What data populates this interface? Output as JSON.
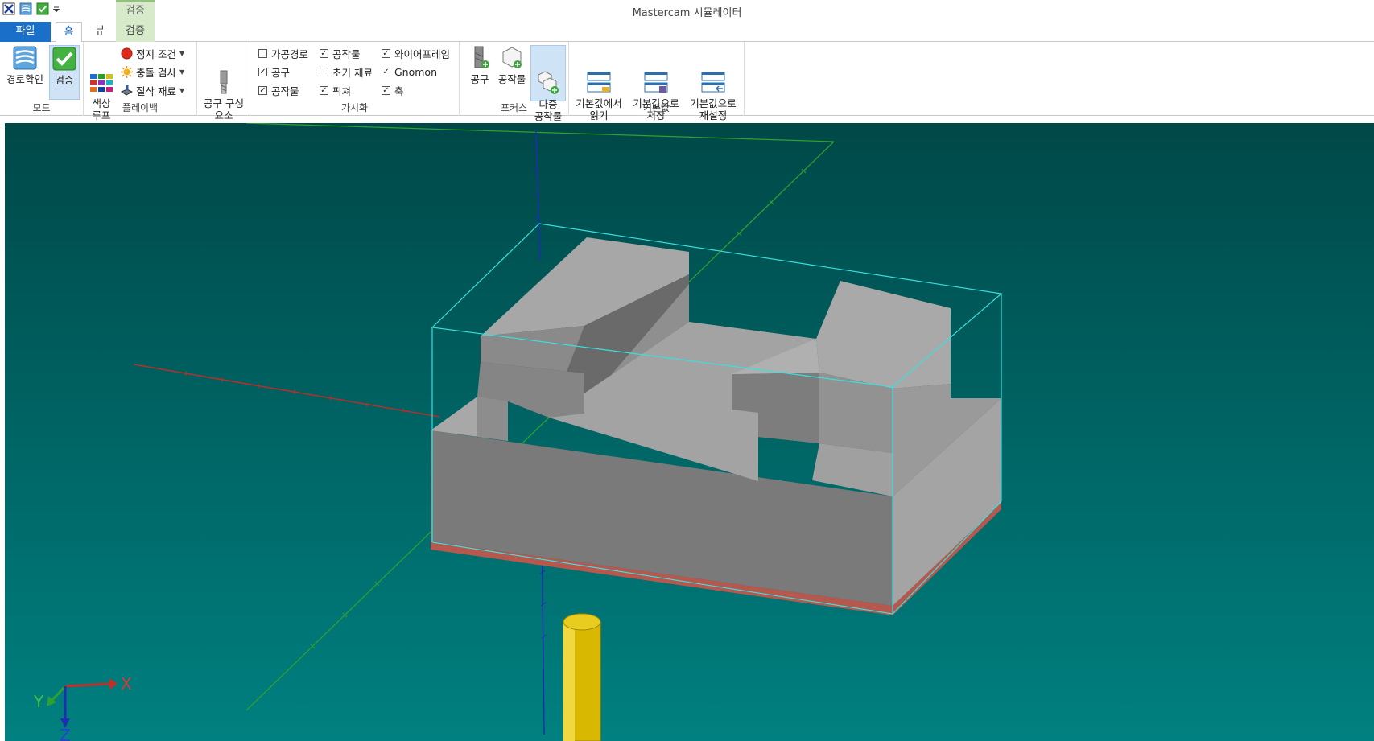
{
  "window": {
    "title": "Mastercam 시뮬레이터"
  },
  "quick_access": {
    "icons": [
      "app-icon",
      "path-icon",
      "verify-icon",
      "qat-dropdown-icon"
    ]
  },
  "context_group": {
    "label": "검증"
  },
  "tabs": {
    "file": "파일",
    "home": "홈",
    "view": "뷰",
    "verify": "검증"
  },
  "ribbon": {
    "mode": {
      "label": "모드",
      "backplot": "경로확인",
      "verify": "검증"
    },
    "playback": {
      "label": "플레이백",
      "color_loop": "색상\n루프",
      "stop_conditions": "정지 조건",
      "collision_check": "충돌 검사",
      "cut_stock": "절삭 재료"
    },
    "tool_config": {
      "label": "공구 구성\n요소"
    },
    "visibility": {
      "label": "가시화",
      "items": [
        {
          "text": "가공경로",
          "checked": false
        },
        {
          "text": "공구",
          "checked": true
        },
        {
          "text": "공작물",
          "checked": true
        },
        {
          "text": "공작물",
          "checked": true
        },
        {
          "text": "초기 재료",
          "checked": false
        },
        {
          "text": "픽쳐",
          "checked": true
        },
        {
          "text": "와이어프레임",
          "checked": true
        },
        {
          "text": "Gnomon",
          "checked": true
        },
        {
          "text": "축",
          "checked": true
        }
      ]
    },
    "focus": {
      "label": "포커스",
      "tool": "공구",
      "workpiece": "공작물",
      "multi_workpiece": "다중\n공작물"
    },
    "defaults": {
      "label": "기본값",
      "load": "기본값에서\n읽기",
      "save": "기본값으로\n저장",
      "reset": "기본값으로\n재설정"
    }
  },
  "viewport": {
    "background_top": "#004848",
    "background_bottom": "#008080",
    "gnomon": {
      "x": "X",
      "y": "Y",
      "z": "Z"
    },
    "colors": {
      "x_axis": "#c0302a",
      "y_axis": "#2ea12e",
      "z_axis": "#1d2fb0",
      "stock_box": "#38e0e0",
      "tool": "#d8b800"
    }
  }
}
